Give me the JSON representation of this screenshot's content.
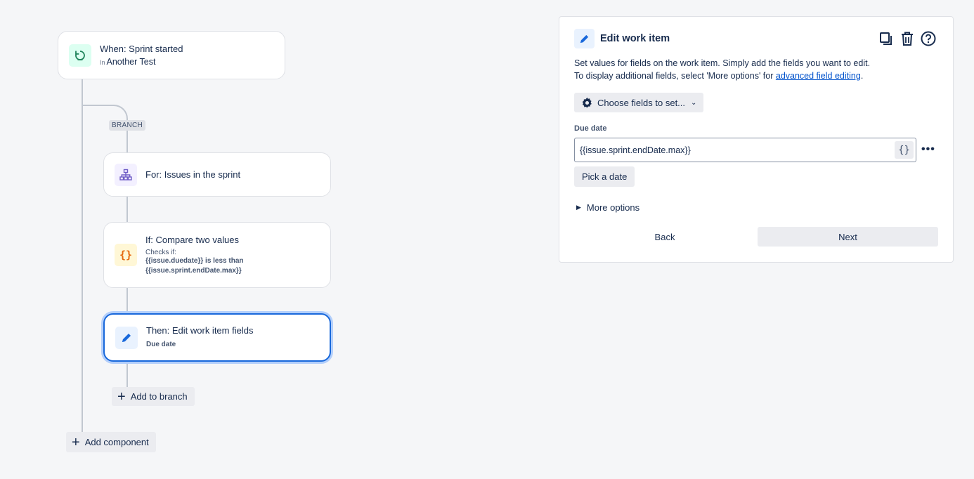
{
  "trigger": {
    "title": "When: Sprint started",
    "in_label": "In",
    "project": "Another Test",
    "icon": "sprint-trigger-icon",
    "icon_color": "#1f845a"
  },
  "branch": {
    "tag": "BRANCH"
  },
  "for_card": {
    "title": "For: Issues in the sprint",
    "icon": "branch-hierarchy-icon"
  },
  "if_card": {
    "title": "If: Compare two values",
    "checks_label": "Checks if:",
    "line1": "{{issue.duedate}} is less than",
    "line2": "{{issue.sprint.endDate.max}}",
    "icon": "curly-braces-icon"
  },
  "then_card": {
    "title": "Then: Edit work item fields",
    "subtitle": "Due date",
    "icon": "pencil-icon"
  },
  "add_to_branch": "Add to branch",
  "add_component": "Add component",
  "panel": {
    "title": "Edit work item",
    "desc_line1": "Set values for fields on the work item. Simply add the fields you want to edit.",
    "desc_line2_prefix": "To display additional fields, select 'More options' for ",
    "desc_link": "advanced field editing",
    "desc_line2_suffix": ".",
    "choose_fields": "Choose fields to set...",
    "field_label": "Due date",
    "field_value": "{{issue.sprint.endDate.max}}",
    "brace_button": "{}",
    "more_actions": "•••",
    "pick_date": "Pick a date",
    "more_options": "More options",
    "back": "Back",
    "next": "Next"
  },
  "colors": {
    "accent": "#1868db",
    "link": "#0052cc"
  }
}
